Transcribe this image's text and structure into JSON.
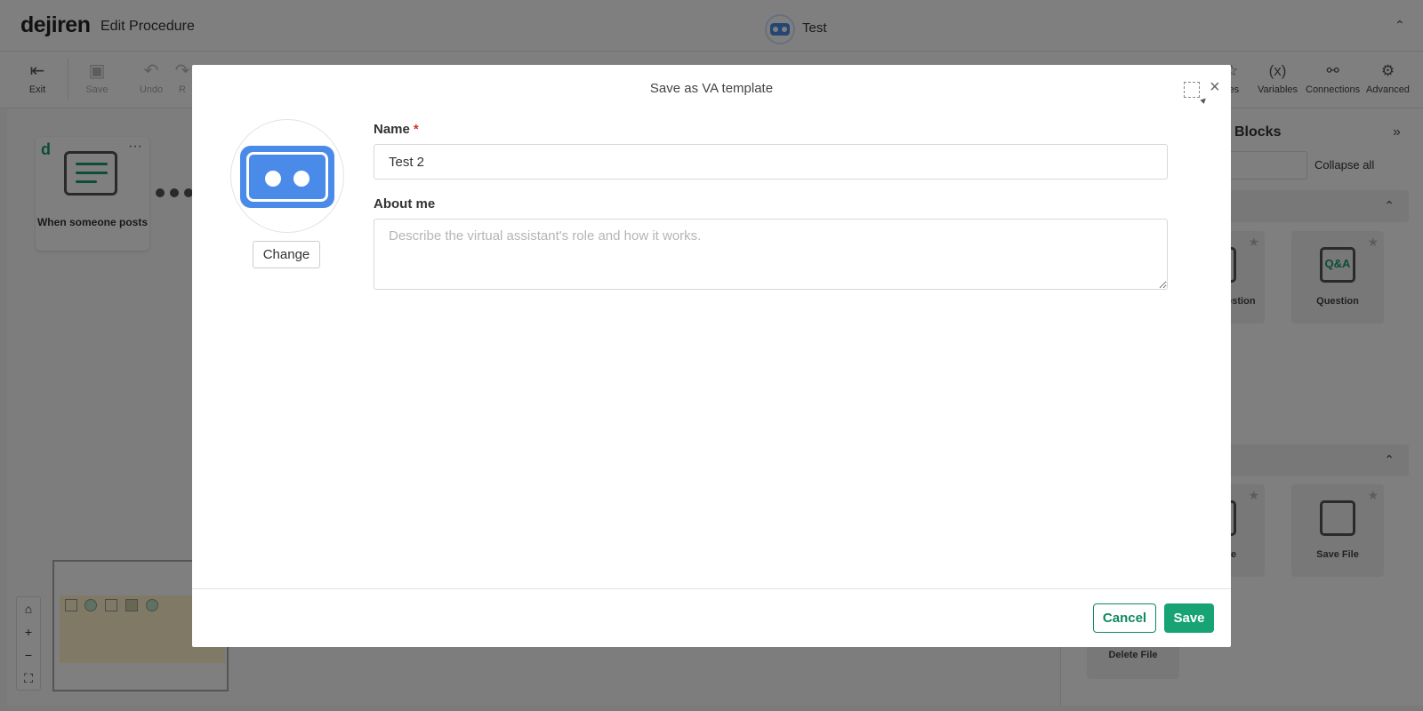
{
  "app": {
    "brand": "dejiren",
    "page_title": "Edit Procedure",
    "va_name": "Test"
  },
  "toolbar": {
    "exit": "Exit",
    "save": "Save",
    "undo": "Undo",
    "redo_partial": "R",
    "favorites_partial": "ites",
    "variables": "Variables",
    "connections": "Connections",
    "advanced": "Advanced",
    "variables_glyph": "(x)"
  },
  "canvas": {
    "trigger_label": "When someone posts",
    "trigger_logo": "d",
    "more": "···"
  },
  "zoom": {
    "home": "⌂",
    "plus": "+",
    "minus": "−",
    "fit": "⛶"
  },
  "right_panel": {
    "title": "Blocks",
    "expand": "»",
    "collapse_all": "Collapse all",
    "blocks": {
      "multiple_choice": "le-choice estion",
      "question": "Question",
      "question_glyph": "Q&A",
      "retrieve_file": "eve File",
      "save_file": "Save File",
      "delete_file": "Delete File"
    }
  },
  "modal": {
    "title": "Save as VA template",
    "close": "×",
    "change_button": "Change",
    "name_label": "Name",
    "name_required": "*",
    "name_value": "Test 2",
    "about_label": "About me",
    "about_placeholder": "Describe the virtual assistant's role and how it works.",
    "cancel_button": "Cancel",
    "save_button": "Save"
  },
  "colors": {
    "primary_green": "#18a374",
    "avatar_blue": "#4a8ae8",
    "required_red": "#d0342c"
  }
}
